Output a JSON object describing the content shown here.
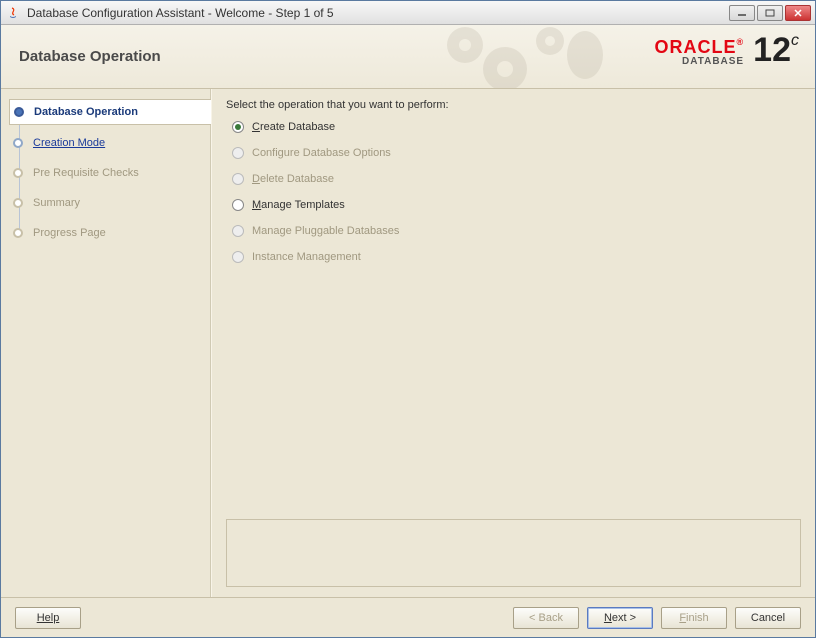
{
  "window": {
    "title": "Database Configuration Assistant - Welcome - Step 1 of 5"
  },
  "header": {
    "title": "Database Operation",
    "brand_top": "ORACLE",
    "brand_reg": "®",
    "brand_sub": "DATABASE",
    "brand_ver": "12",
    "brand_ver_sup": "c"
  },
  "sidebar": {
    "steps": [
      {
        "label": "Database Operation",
        "state": "active"
      },
      {
        "label": "Creation Mode",
        "state": "link"
      },
      {
        "label": "Pre Requisite Checks",
        "state": "disabled"
      },
      {
        "label": "Summary",
        "state": "disabled"
      },
      {
        "label": "Progress Page",
        "state": "disabled"
      }
    ]
  },
  "main": {
    "prompt": "Select the operation that you want to perform:",
    "options": [
      {
        "accel": "C",
        "rest": "reate Database",
        "selected": true,
        "enabled": true
      },
      {
        "accel": "",
        "rest": "Configure Database Options",
        "selected": false,
        "enabled": false
      },
      {
        "accel": "D",
        "rest": "elete Database",
        "selected": false,
        "enabled": false
      },
      {
        "accel": "M",
        "rest": "anage Templates",
        "selected": false,
        "enabled": true
      },
      {
        "accel": "",
        "rest": "Manage Pluggable Databases",
        "selected": false,
        "enabled": false
      },
      {
        "accel": "",
        "rest": "Instance Management",
        "selected": false,
        "enabled": false
      }
    ]
  },
  "footer": {
    "help": "Help",
    "back": "< Back",
    "next_accel": "N",
    "next_rest": "ext >",
    "finish_accel": "F",
    "finish_rest": "inish",
    "cancel": "Cancel"
  }
}
